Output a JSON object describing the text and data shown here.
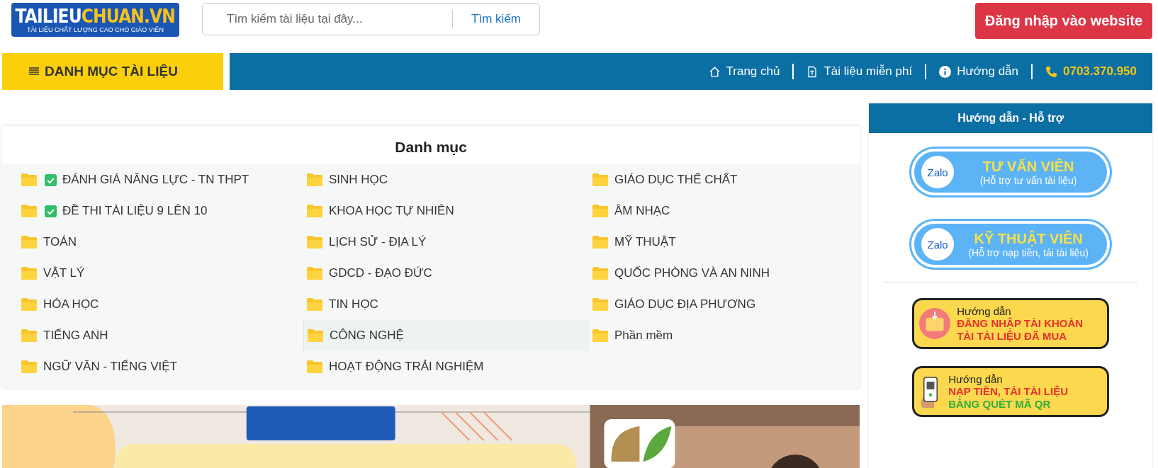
{
  "header": {
    "logo": {
      "brand_left": "TAILIEU",
      "brand_right": "CHUAN.VN",
      "tagline": "TÀI LIỆU CHẤT LƯỢNG CAO CHO GIÁO VIÊN"
    },
    "search": {
      "placeholder": "Tìm kiếm tài liệu tại đây...",
      "button": "Tìm kiếm"
    },
    "login_button": "Đăng nhập vào website"
  },
  "navbar": {
    "menu_button": "DANH MỤC TÀI LIỆU",
    "links": [
      {
        "kind": "home",
        "label": "Trang chủ"
      },
      {
        "kind": "document",
        "label": "Tài liệu miễn phí"
      },
      {
        "kind": "info",
        "label": "Hướng dẫn"
      },
      {
        "kind": "phone",
        "label": "0703.370.950"
      }
    ]
  },
  "categories": {
    "title": "Danh mục",
    "items": [
      {
        "label": "ĐÁNH GIÁ NĂNG LỰC - TN THPT",
        "checked": true,
        "selected": false
      },
      {
        "label": "SINH HỌC",
        "checked": false,
        "selected": false
      },
      {
        "label": "GIÁO DỤC THỂ CHẤT",
        "checked": false,
        "selected": false
      },
      {
        "label": "ĐỀ THI TÀI LIỆU 9 LÊN 10",
        "checked": true,
        "selected": false
      },
      {
        "label": "KHOA HỌC TỰ NHIÊN",
        "checked": false,
        "selected": false
      },
      {
        "label": "ÂM NHẠC",
        "checked": false,
        "selected": false
      },
      {
        "label": "TOÁN",
        "checked": false,
        "selected": false
      },
      {
        "label": "LỊCH SỬ - ĐỊA LÝ",
        "checked": false,
        "selected": false
      },
      {
        "label": "MỸ THUẬT",
        "checked": false,
        "selected": false
      },
      {
        "label": "VẬT LÝ",
        "checked": false,
        "selected": false
      },
      {
        "label": "GDCD - ĐẠO ĐỨC",
        "checked": false,
        "selected": false
      },
      {
        "label": "QUỐC PHÒNG VÀ AN NINH",
        "checked": false,
        "selected": false
      },
      {
        "label": "HÓA HỌC",
        "checked": false,
        "selected": false
      },
      {
        "label": "TIN HỌC",
        "checked": false,
        "selected": false
      },
      {
        "label": "GIÁO DỤC ĐỊA PHƯƠNG",
        "checked": false,
        "selected": false
      },
      {
        "label": "TIẾNG ANH",
        "checked": false,
        "selected": false
      },
      {
        "label": "CÔNG NGHỆ",
        "checked": false,
        "selected": true
      },
      {
        "label": "Phần mềm",
        "checked": false,
        "selected": false
      },
      {
        "label": "NGỮ VĂN - TIẾNG VIỆT",
        "checked": false,
        "selected": false
      },
      {
        "label": "HOẠT ĐỘNG TRẢI NGHIỆM",
        "checked": false,
        "selected": false
      }
    ]
  },
  "sidebar": {
    "title": "Hướng dẫn - Hỗ trợ",
    "items": [
      {
        "kind": "zalo",
        "icon_text": "Zalo",
        "title": "TƯ VẤN VIÊN",
        "subtitle": "(Hỗ trợ tư vấn tài liệu)"
      },
      {
        "kind": "zalo",
        "icon_text": "Zalo",
        "title": "KỸ THUẬT VIÊN",
        "subtitle": "(Hỗ trợ nạp tiền, tải tài liệu)"
      },
      {
        "kind": "download_guide",
        "title": "Hướng dẫn",
        "lines": [
          {
            "text": "ĐĂNG NHẬP TÀI KHOẢN",
            "color": "#e5322d"
          },
          {
            "text": "TẢI TÀI LIỆU ĐÃ MUA",
            "color": "#e5322d"
          }
        ]
      },
      {
        "kind": "qr_guide",
        "title": "Hướng dẫn",
        "lines": [
          {
            "text": "NẠP TIỀN, TẢI TÀI LIỆU",
            "color": "#e5322d"
          },
          {
            "text": "BẰNG QUÉT MÃ QR",
            "color": "#2fae3a"
          }
        ]
      }
    ]
  }
}
